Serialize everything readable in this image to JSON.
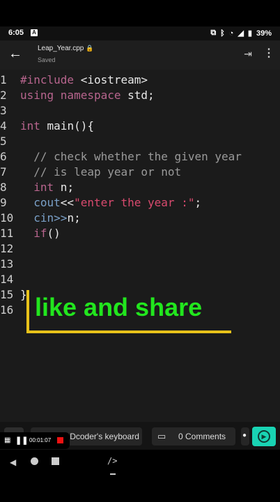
{
  "status": {
    "time": "6:05",
    "notif_icon": "A",
    "battery": "39%"
  },
  "appbar": {
    "file_name": "Leap_Year.cpp",
    "subtitle": "Saved"
  },
  "editor": {
    "lines": [
      {
        "n": "1",
        "parts": [
          {
            "t": "#include",
            "c": "kw"
          },
          {
            "t": " <iostream>",
            "c": "pl"
          }
        ]
      },
      {
        "n": "2",
        "parts": [
          {
            "t": "using namespace",
            "c": "kw"
          },
          {
            "t": " std;",
            "c": "pl"
          }
        ]
      },
      {
        "n": "3",
        "parts": []
      },
      {
        "n": "4",
        "parts": [
          {
            "t": "int",
            "c": "kw"
          },
          {
            "t": " main(){",
            "c": "pl"
          }
        ]
      },
      {
        "n": "5",
        "parts": []
      },
      {
        "n": "6",
        "parts": [
          {
            "t": "  // check whether the given year",
            "c": "cm"
          }
        ]
      },
      {
        "n": "7",
        "parts": [
          {
            "t": "  // is leap year or not",
            "c": "cm"
          }
        ]
      },
      {
        "n": "8",
        "parts": [
          {
            "t": "  ",
            "c": "pl"
          },
          {
            "t": "int",
            "c": "kw"
          },
          {
            "t": " n;",
            "c": "pl"
          }
        ]
      },
      {
        "n": "9",
        "parts": [
          {
            "t": "  ",
            "c": "pl"
          },
          {
            "t": "cout",
            "c": "io"
          },
          {
            "t": "<<",
            "c": "pl"
          },
          {
            "t": "\"enter the year :\"",
            "c": "st"
          },
          {
            "t": ";",
            "c": "pl"
          }
        ]
      },
      {
        "n": "10",
        "parts": [
          {
            "t": "  ",
            "c": "pl"
          },
          {
            "t": "cin>>",
            "c": "io"
          },
          {
            "t": "n;",
            "c": "pl"
          }
        ]
      },
      {
        "n": "11",
        "parts": [
          {
            "t": "  ",
            "c": "pl"
          },
          {
            "t": "if",
            "c": "kw"
          },
          {
            "t": "()",
            "c": "pl"
          }
        ]
      },
      {
        "n": "12",
        "parts": []
      },
      {
        "n": "13",
        "parts": []
      },
      {
        "n": "14",
        "parts": []
      },
      {
        "n": "15",
        "parts": [
          {
            "t": "}",
            "c": "pl"
          }
        ]
      },
      {
        "n": "16",
        "parts": []
      }
    ]
  },
  "overlay": {
    "text": "like and share"
  },
  "bottom": {
    "keyboard_label": "Try Dcoder's keyboard",
    "comments_label": "0 Comments"
  },
  "recorder": {
    "timer": "00:01:07"
  },
  "colors": {
    "accent": "#19d3b3",
    "overlay_text": "#22e61e",
    "overlay_border": "#e8c21a"
  }
}
